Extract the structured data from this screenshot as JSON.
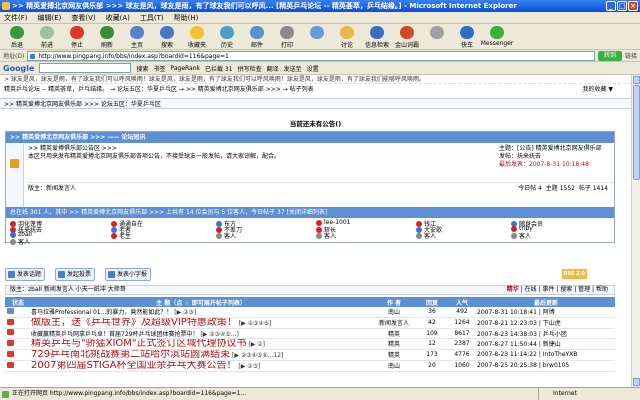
{
  "window": {
    "title": ">> 精英爱搏北京网友俱乐部 >>> 球友是风，球友是雨，有了球友我们可以呼风... [精英乒乓论坛 -- 精英荟萃，乒乓结缘。] - Microsoft Internet Explorer",
    "buttons": [
      "_",
      "□",
      "×"
    ]
  },
  "menubar": [
    "文件(F)",
    "编辑(E)",
    "查看(V)",
    "收藏(A)",
    "工具(T)",
    "帮助(H)"
  ],
  "toolbar": [
    {
      "label": "后退",
      "icon": "back-icon",
      "color": "#3a9b3a"
    },
    {
      "label": "前进",
      "icon": "forward-icon",
      "color": "#9fbf9f"
    },
    {
      "label": "停止",
      "icon": "stop-icon",
      "color": "#d83a2a"
    },
    {
      "label": "刷新",
      "icon": "refresh-icon",
      "color": "#3a8b3a"
    },
    {
      "label": "主页",
      "icon": "home-icon",
      "color": "#5a7fcf"
    },
    {
      "label": "搜索",
      "icon": "search-icon",
      "color": "#4a78c8"
    },
    {
      "label": "收藏夹",
      "icon": "favorites-icon",
      "color": "#f2c12e"
    },
    {
      "label": "历史",
      "icon": "history-icon",
      "color": "#4aa0c8"
    },
    {
      "label": "邮件",
      "icon": "mail-icon",
      "color": "#5a8fd0"
    },
    {
      "label": "打印",
      "icon": "print-icon",
      "color": "#8a8a8a"
    },
    {
      "label": "",
      "icon": "edit-icon",
      "color": "#6a9ad8"
    },
    {
      "label": "讨论",
      "icon": "discuss-icon",
      "color": "#e8b84a"
    },
    {
      "label": "信息检索",
      "icon": "research-icon",
      "color": "#3a6fc8"
    },
    {
      "label": "金山词霸",
      "icon": "dictionary-icon",
      "color": "#d04a2a"
    },
    {
      "label": "",
      "icon": "flag-icon",
      "color": "#a0a0a0"
    },
    {
      "label": "快车",
      "icon": "flashget-icon",
      "color": "#2a6fc8"
    },
    {
      "label": "Messenger",
      "icon": "messenger-icon",
      "color": "#3ab03a"
    }
  ],
  "address": {
    "label": "地址(D)",
    "url": "http://www.pingpang.info/bbs/index.asp?boardid=116&page=1",
    "go": "转到",
    "links": "链接"
  },
  "googlebar": {
    "logo": "Google",
    "items": [
      "搜索",
      "书签",
      "PageRank",
      "已拦截 31",
      "拼写检查",
      "翻译",
      "发送至",
      "设置"
    ]
  },
  "page": {
    "marquee": "> 球友是风，球友是雨，有了球友我们可以呼风唤雨！球友是风，球友是雨，有了球友我们可以呼风唤雨！球友是风，球友是雨，有了球友我们能够呼风唤雨。",
    "crumb": "精英乒乓论坛 -- 精英荟萃，乒乓结缘。 → 论坛五区：华夏乒乓区 → >> 精英爱搏北京网友俱乐部 >>> → 帖子列表",
    "my_favorites": "我的收藏 ▼",
    "board_header": ">> 精英爱搏北京网友俱乐部 >>> 论坛五区：华夏乒乓区",
    "no_announcement": "当前还未有公告()",
    "announce_head": ">> 精英爱搏北京网友俱乐部 >>> —— 论坛短讯",
    "announce_title": ">> 精英爱搏俱乐部公告区 >>>",
    "announce_text": "本区只用来发布精英爱搏北京网友俱乐部各项公告，不接受球友一般发帖，请大家谅解，配合。",
    "announce_side": [
      "主题：[公告] 精英爱搏北京网友俱乐部",
      "发帖：抚来抚去",
      "最后发表：2007-8-31 10:18:48"
    ],
    "announce_moderator": "版主：新闻发言人",
    "announce_stats": [
      "今日帖 4",
      "主题 1552",
      "帖子 1414"
    ],
    "online_head": "总在线 301 人，其中 >> 精英爱搏北京网友俱乐部 >>> 上共有 14 位会员与 5 位客人，今日帖子 37 [关闭详细列表]",
    "online_count_today": "37",
    "online_users": [
      [
        "羽化蓬博",
        "通通自在",
        "东方",
        "lee-1001",
        "钱江",
        "随身会员"
      ],
      [
        "抚来抚去",
        "老者",
        "不差刀",
        "斩长",
        "大安歌",
        "triby"
      ],
      [
        "zball",
        "老生",
        "客人",
        "客人",
        "客人",
        "客人"
      ],
      [
        "客人"
      ]
    ],
    "actions": [
      "发表话题",
      "发起投票",
      "发表小字报"
    ],
    "rss": "RSS 2.0",
    "moderators": "版主：zball 新闻发言人 小天一纸冲 大师哥",
    "board_tools": [
      "精华",
      "在线",
      "事件",
      "搜索",
      "管理",
      "帮助"
    ],
    "table_headers": [
      "状态",
      "主 题（点 ☆ 即可展开帖子列表）",
      "作 者",
      "回复",
      "人气",
      "最后更新"
    ],
    "topics": [
      {
        "title": "喜马拉雅Professional 01...的暴力，竟然能如此？！",
        "big": false,
        "pages": "[▶ ②③]",
        "author": "南山",
        "replies": "36",
        "views": "492",
        "last": "2007-8-31 10:18:41",
        "lastuser": "| 阿博"
      },
      {
        "title": "做版主，送《乒乓世界》及超级VIP特惠政策！",
        "big": true,
        "color": "red",
        "pages": "[▶ ②③④⑤]",
        "author": "新闻发言人",
        "replies": "42",
        "views": "1264",
        "last": "2007-8-21 12:23:03",
        "lastuser": "| 下山虎"
      },
      {
        "title": "收藏赢精英乒乓网拿乒乓卓！首届729杯乒乓球团体赛抢票中！",
        "big": false,
        "pages": "[▶ ②③④⑤...]",
        "author": "精英",
        "replies": "109",
        "views": "8617",
        "last": "2007-8-23 14:38:03",
        "lastuser": "| 乒乓小团"
      },
      {
        "title": "精英乒乓与\"骄猛XIOM\"正式签订区域代理协议书",
        "big": true,
        "color": "red",
        "pages": "[▶ ②]",
        "author": "精英",
        "replies": "12",
        "views": "2387",
        "last": "2007-8-27 11:50:44",
        "lastuser": "| 新捷山"
      },
      {
        "title": "729乒乓南北挑战赛第二站哈尔滨站圆满结束",
        "big": true,
        "color": "red",
        "pages": "[▶ ②③④⑤⑥...12]",
        "author": "精英",
        "replies": "173",
        "views": "4776",
        "last": "2007-8-23 11:14:22",
        "lastuser": "| IntoTheYXB"
      },
      {
        "title": "2007第四届STIGA杯全国业余乒乓大赛公告！",
        "big": true,
        "color": "red",
        "pages": "[▶ ②③]",
        "author": "南山",
        "replies": "20",
        "views": "1060",
        "last": "2007-8-25 20:25:38",
        "lastuser": "| brw0105"
      }
    ]
  },
  "statusbar": {
    "url": "正在打开网页 http://www.pingpang.info/bbs/index.asp?boardid=116&page=1...",
    "zone": "Internet"
  }
}
